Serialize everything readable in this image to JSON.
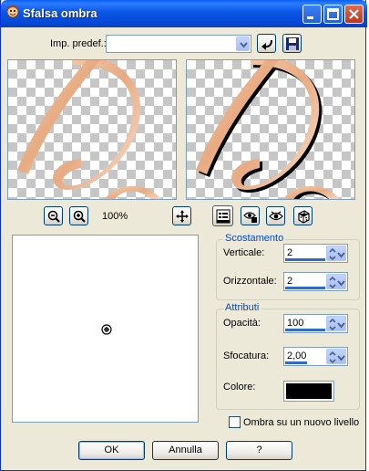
{
  "window": {
    "title": "Sfalsa ombra"
  },
  "presets": {
    "label": "Imp. predef.:",
    "value": ""
  },
  "zoom": {
    "level": "100%"
  },
  "offset_group": {
    "title": "Scostamento",
    "vertical": {
      "label": "Verticale:",
      "value": "2"
    },
    "horizontal": {
      "label": "Orizzontale:",
      "value": "2"
    }
  },
  "attributes_group": {
    "title": "Attributi",
    "opacity": {
      "label": "Opacità:",
      "value": "100"
    },
    "blur": {
      "label": "Sfocatura:",
      "value": "2,00"
    },
    "color": {
      "label": "Colore:",
      "value": "#000000"
    }
  },
  "new_layer_checkbox": {
    "label": "Ombra su un nuovo livello",
    "checked": false
  },
  "buttons": {
    "ok": "OK",
    "cancel": "Annulla",
    "help": "?"
  },
  "colors": {
    "titlebar": "#0a55e6",
    "dialog": "#ece9d8",
    "accent": "#0046d5"
  }
}
